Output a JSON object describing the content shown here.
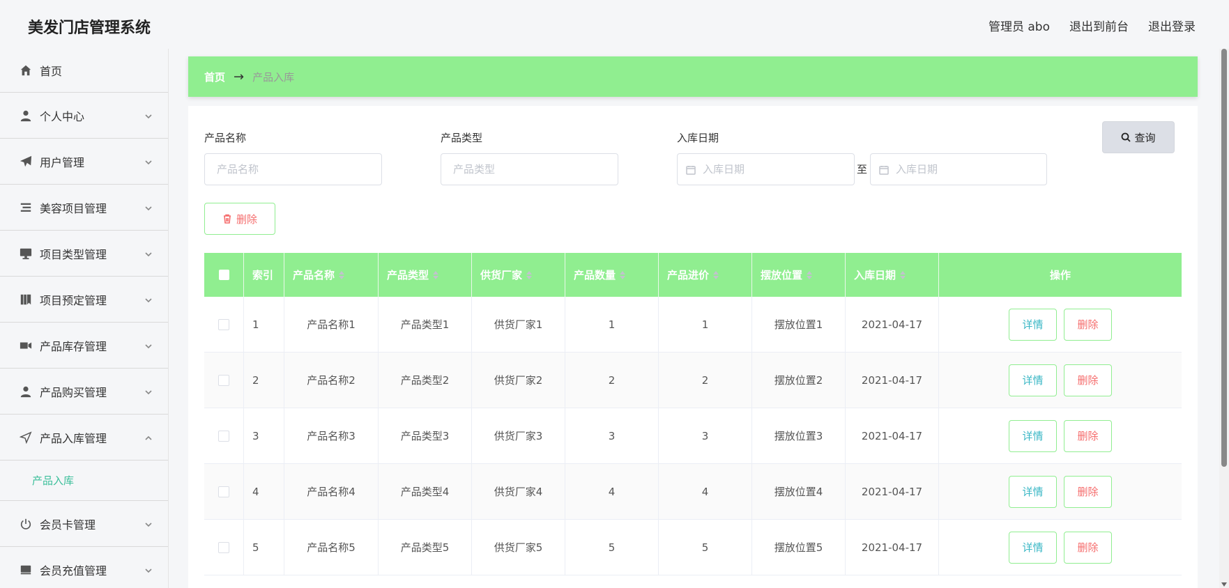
{
  "header": {
    "app_title": "美发门店管理系统",
    "admin_label": "管理员 abo",
    "exit_front": "退出到前台",
    "logout": "退出登录"
  },
  "sidebar": {
    "items": [
      {
        "label": "首页",
        "icon": "home-icon"
      },
      {
        "label": "个人中心",
        "icon": "user-icon"
      },
      {
        "label": "用户管理",
        "icon": "paper-plane-icon"
      },
      {
        "label": "美容项目管理",
        "icon": "list-icon"
      },
      {
        "label": "项目类型管理",
        "icon": "monitor-icon"
      },
      {
        "label": "项目预定管理",
        "icon": "bookmark-icon"
      },
      {
        "label": "产品库存管理",
        "icon": "ticket-icon"
      },
      {
        "label": "产品购买管理",
        "icon": "user-icon"
      },
      {
        "label": "产品入库管理",
        "icon": "send-icon"
      },
      {
        "label": "会员卡管理",
        "icon": "power-icon"
      },
      {
        "label": "会员充值管理",
        "icon": "card-icon"
      }
    ],
    "active_submenu": "产品入库"
  },
  "breadcrumb": {
    "home": "首页",
    "current": "产品入库"
  },
  "search": {
    "name_label": "产品名称",
    "name_placeholder": "产品名称",
    "type_label": "产品类型",
    "type_placeholder": "产品类型",
    "date_label": "入库日期",
    "date_start_placeholder": "入库日期",
    "date_end_placeholder": "入库日期",
    "range_separator": "至",
    "query_button": "查询",
    "delete_button": "删除"
  },
  "table": {
    "columns": [
      "索引",
      "产品名称",
      "产品类型",
      "供货厂家",
      "产品数量",
      "产品进价",
      "摆放位置",
      "入库日期",
      "操作"
    ],
    "rows": [
      {
        "index": "1",
        "name": "产品名称1",
        "type": "产品类型1",
        "supplier": "供货厂家1",
        "qty": "1",
        "price": "1",
        "location": "摆放位置1",
        "date": "2021-04-17"
      },
      {
        "index": "2",
        "name": "产品名称2",
        "type": "产品类型2",
        "supplier": "供货厂家2",
        "qty": "2",
        "price": "2",
        "location": "摆放位置2",
        "date": "2021-04-17"
      },
      {
        "index": "3",
        "name": "产品名称3",
        "type": "产品类型3",
        "supplier": "供货厂家3",
        "qty": "3",
        "price": "3",
        "location": "摆放位置3",
        "date": "2021-04-17"
      },
      {
        "index": "4",
        "name": "产品名称4",
        "type": "产品类型4",
        "supplier": "供货厂家4",
        "qty": "4",
        "price": "4",
        "location": "摆放位置4",
        "date": "2021-04-17"
      },
      {
        "index": "5",
        "name": "产品名称5",
        "type": "产品类型5",
        "supplier": "供货厂家5",
        "qty": "5",
        "price": "5",
        "location": "摆放位置5",
        "date": "2021-04-17"
      }
    ],
    "detail_label": "详情",
    "delete_label": "删除"
  },
  "colors": {
    "accent_green": "#90ee90",
    "danger_red": "#f56c6c",
    "info_teal": "#3ab7c5",
    "active_menu": "#3bbf9a"
  }
}
